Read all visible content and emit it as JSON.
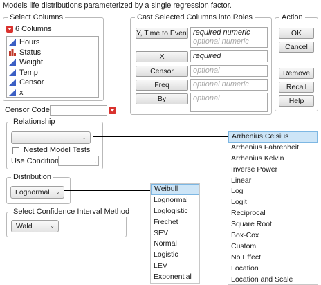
{
  "description": "Models life distributions parameterized by a single regression factor.",
  "select_columns": {
    "title": "Select Columns",
    "count_label": "6 Columns",
    "columns": [
      {
        "name": "Hours",
        "icon": "continuous-icon",
        "color": "#3b5fc4"
      },
      {
        "name": "Status",
        "icon": "nominal-icon",
        "color": "#c0392b"
      },
      {
        "name": "Weight",
        "icon": "continuous-icon",
        "color": "#3b5fc4"
      },
      {
        "name": "Temp",
        "icon": "continuous-icon",
        "color": "#3b5fc4"
      },
      {
        "name": "Censor",
        "icon": "continuous-icon",
        "color": "#3b5fc4"
      },
      {
        "name": "x",
        "icon": "continuous-icon",
        "color": "#3b5fc4"
      }
    ]
  },
  "roles": {
    "title": "Cast Selected Columns into Roles",
    "y_button": "Y, Time to Event",
    "y_required": "required numeric",
    "y_optional": "optional numeric",
    "x_button": "X",
    "x_required": "required",
    "censor_button": "Censor",
    "censor_optional": "optional",
    "freq_button": "Freq",
    "freq_optional": "optional numeric",
    "by_button": "By",
    "by_optional": "optional"
  },
  "action": {
    "title": "Action",
    "ok": "OK",
    "cancel": "Cancel",
    "remove": "Remove",
    "recall": "Recall",
    "help": "Help"
  },
  "censor_code": {
    "label": "Censor Code:",
    "value": ""
  },
  "relationship": {
    "title": "Relationship",
    "selected": "",
    "nested_label": "Nested Model Tests",
    "use_condition_label": "Use Condition",
    "use_condition_value": ".",
    "options": [
      "Arrhenius Celsius",
      "Arrhenius Fahrenheit",
      "Arrhenius Kelvin",
      "Inverse Power",
      "Linear",
      "Log",
      "Logit",
      "Reciprocal",
      "Square Root",
      "Box-Cox",
      "Custom",
      "No Effect",
      "Location",
      "Location and Scale"
    ],
    "highlighted": "Arrhenius Celsius"
  },
  "distribution": {
    "title": "Distribution",
    "selected": "Lognormal",
    "options": [
      "Weibull",
      "Lognormal",
      "Loglogistic",
      "Frechet",
      "SEV",
      "Normal",
      "Logistic",
      "LEV",
      "Exponential"
    ],
    "highlighted": "Weibull"
  },
  "ci_method": {
    "title": "Select Confidence Interval Method",
    "selected": "Wald"
  }
}
